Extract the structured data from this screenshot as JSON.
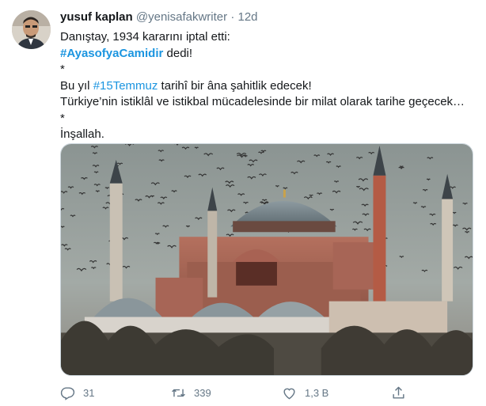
{
  "tweet": {
    "author": {
      "name": "yusuf kaplan",
      "handle": "@yenisafakwriter",
      "time": "12d"
    },
    "lines": {
      "l1": "Danıştay, 1934 kararını iptal etti:",
      "l2_hashtag": "#AyasofyaCamidir",
      "l2_rest": " dedi!",
      "l3": "*",
      "l4_pre": "Bu yıl ",
      "l4_hashtag": "#15Temmuz",
      "l4_post": " tarihî bir âna şahitlik edecek!",
      "l5": "Türkiye’nin istiklâl ve istikbal mücadelesinde bir milat olarak tarihe geçecek…",
      "l6": "*",
      "l7": "İnşallah."
    },
    "actions": {
      "replies": "31",
      "retweets": "339",
      "likes": "1,3 B"
    },
    "colors": {
      "link": "#1b95e0",
      "muted": "#657786",
      "text": "#14171a"
    }
  },
  "icons": {
    "reply": "reply-icon",
    "retweet": "retweet-icon",
    "like": "heart-icon",
    "share": "share-icon"
  }
}
